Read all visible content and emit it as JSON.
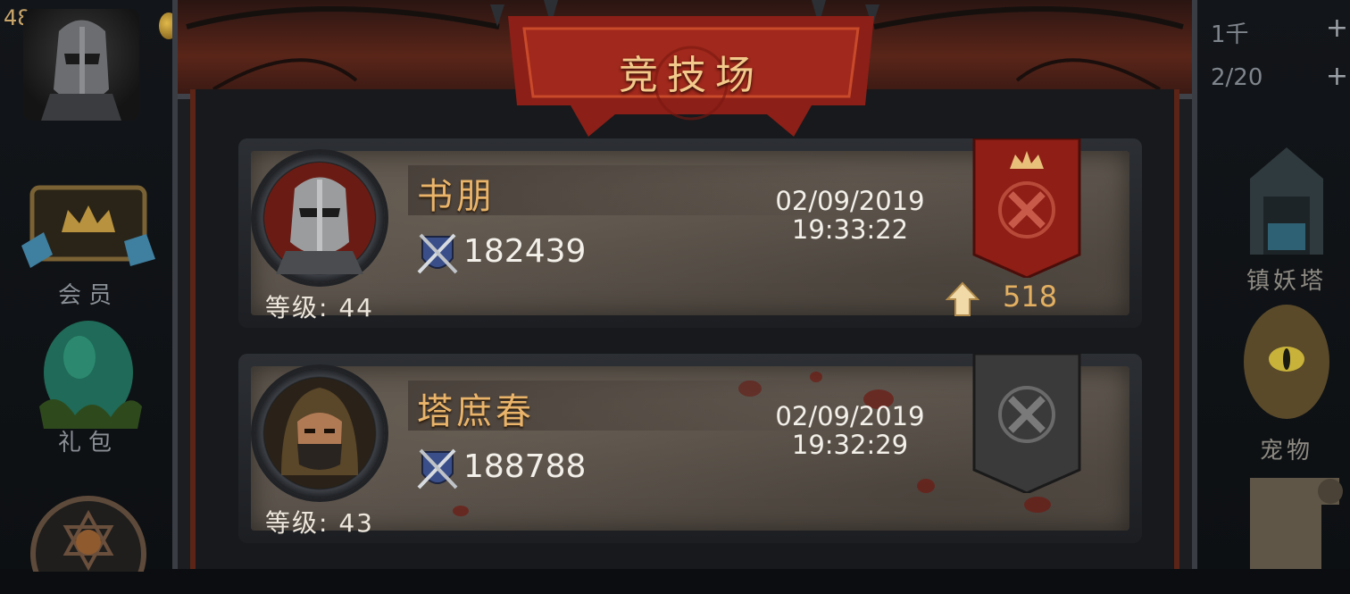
{
  "title": "竞技场",
  "left_sidebar": {
    "level_number": "48",
    "items": [
      {
        "label": "会员",
        "icon": "vip-crown-icon"
      },
      {
        "label": "礼包",
        "icon": "green-egg-gift-icon"
      },
      {
        "label": "",
        "icon": "guild-emblem-icon"
      }
    ]
  },
  "right_sidebar": {
    "resources": [
      {
        "value": "1千",
        "action": "+"
      },
      {
        "value": "2/20",
        "action": "+"
      }
    ],
    "items": [
      {
        "label": "镇妖塔",
        "icon": "tower-icon"
      },
      {
        "label": "宠物",
        "icon": "dragon-egg-icon"
      },
      {
        "label": "",
        "icon": "scroll-icon"
      }
    ]
  },
  "matches": [
    {
      "name": "书朋",
      "level_label": "等级:",
      "level": "44",
      "power": "182439",
      "date": "02/09/2019",
      "time": "19:33:22",
      "result": "win",
      "score": "518",
      "avatar": "knight-helmet-avatar",
      "colors": {
        "banner": "#8e1e16"
      }
    },
    {
      "name": "塔庶春",
      "level_label": "等级:",
      "level": "43",
      "power": "188788",
      "date": "02/09/2019",
      "time": "19:32:29",
      "result": "loss",
      "score": "",
      "avatar": "hooded-assassin-avatar",
      "colors": {
        "banner": "#3a3a3a"
      }
    }
  ]
}
